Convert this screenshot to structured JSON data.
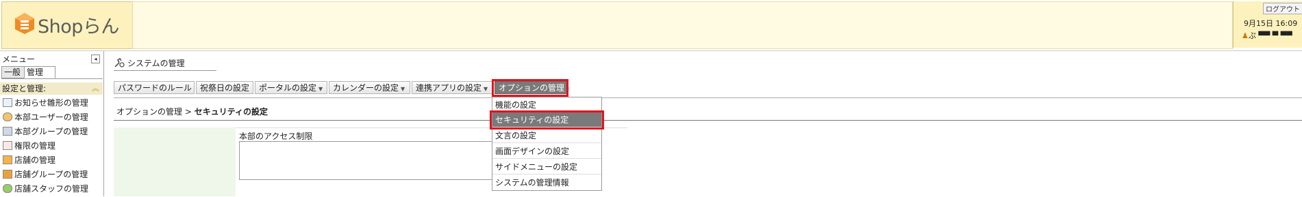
{
  "header": {
    "logo_text": "Shopらん",
    "logout_label": "ログアウト",
    "date": "9月15日 16:09",
    "user_name": "ぷ ▀▀ ▀ ▀▀"
  },
  "sidebar": {
    "title": "メニュー",
    "tabs": [
      "一般",
      "管理"
    ],
    "section_title": "設定と管理:",
    "items": [
      {
        "label": "お知らせ雛形の管理",
        "icon": "notice-template-icon"
      },
      {
        "label": "本部ユーザーの管理",
        "icon": "hq-user-icon"
      },
      {
        "label": "本部グループの管理",
        "icon": "hq-group-icon"
      },
      {
        "label": "権限の管理",
        "icon": "permission-icon"
      },
      {
        "label": "店舗の管理",
        "icon": "store-icon"
      },
      {
        "label": "店舗グループの管理",
        "icon": "store-group-icon"
      },
      {
        "label": "店舗スタッフの管理",
        "icon": "store-staff-icon"
      }
    ]
  },
  "main": {
    "page_title": "システムの管理",
    "toolbar": [
      {
        "label": "パスワードのルール",
        "dropdown": false
      },
      {
        "label": "祝祭日の設定",
        "dropdown": false
      },
      {
        "label": "ポータルの設定",
        "dropdown": true
      },
      {
        "label": "カレンダーの設定",
        "dropdown": true
      },
      {
        "label": "連携アプリの設定",
        "dropdown": true
      },
      {
        "label": "オプションの管理",
        "dropdown": true,
        "active": true
      }
    ],
    "breadcrumb": {
      "parent": "オプションの管理",
      "separator": ">",
      "current": "セキュリティの設定"
    },
    "form": {
      "label": "本部のアクセス制限",
      "value": ""
    }
  },
  "dropdown_menu": {
    "items": [
      {
        "label": "機能の設定"
      },
      {
        "label": "セキュリティの設定",
        "selected": true
      },
      {
        "label": "文言の設定"
      },
      {
        "label": "画面デザインの設定"
      },
      {
        "label": "サイドメニューの設定"
      },
      {
        "label": "システムの管理情報"
      }
    ]
  },
  "colors": {
    "highlight": "#e3131f",
    "header_bg": "#fdf2bd",
    "active_menu": "#7a7a7a",
    "form_label_bg": "#eef7e9"
  }
}
